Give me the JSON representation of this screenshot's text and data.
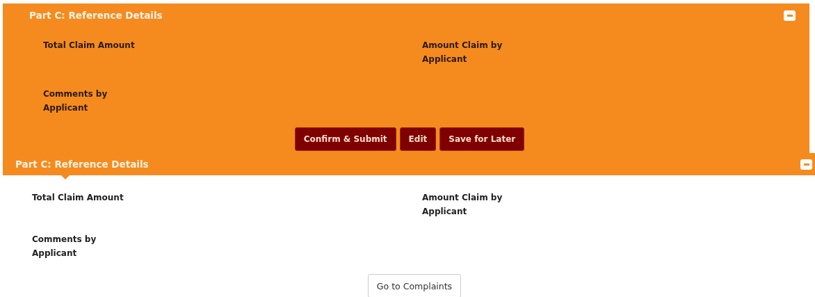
{
  "sections": [
    {
      "title": "Part C: Reference Details",
      "highlighted": true,
      "fields": [
        {
          "label": "Total Claim Amount"
        },
        {
          "label": "Amount Claim by Applicant"
        },
        {
          "label": "Comments by Applicant"
        }
      ],
      "buttons": [
        "Confirm & Submit",
        "Edit",
        "Save for Later"
      ]
    },
    {
      "title": "Part C: Reference Details",
      "highlighted": false,
      "fields": [
        {
          "label": "Total Claim Amount"
        },
        {
          "label": "Amount Claim by Applicant"
        },
        {
          "label": "Comments by Applicant"
        }
      ]
    }
  ],
  "footer_button": "Go to Complaints"
}
